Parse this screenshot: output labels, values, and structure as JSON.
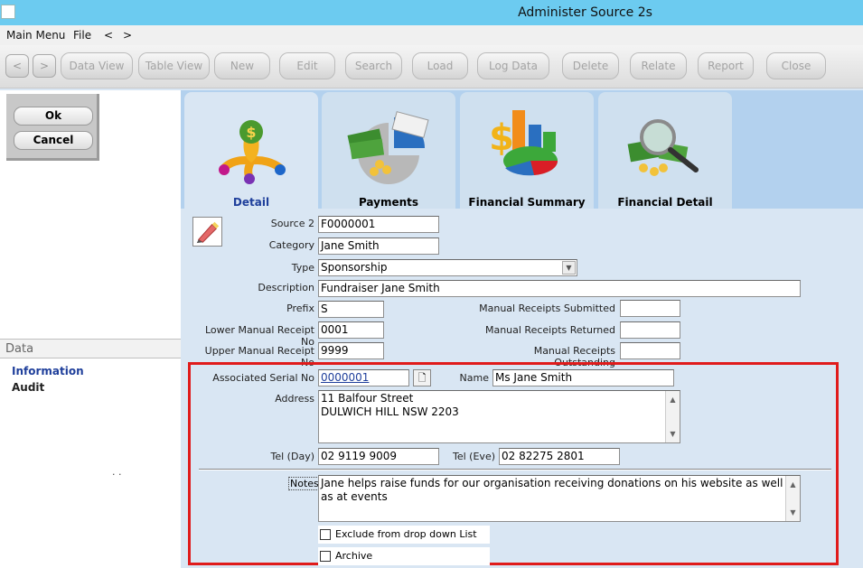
{
  "window": {
    "title": "Administer Source 2s"
  },
  "menu": {
    "items": [
      "Main Menu",
      "File",
      "<",
      ">"
    ]
  },
  "toolbar": {
    "nav_prev": "<",
    "nav_next": ">",
    "buttons": [
      "Data View",
      "Table View",
      "New",
      "Edit",
      "Search",
      "Load",
      "Log Data",
      "Delete",
      "Relate",
      "Report",
      "Close"
    ]
  },
  "dialog": {
    "ok": "Ok",
    "cancel": "Cancel"
  },
  "left": {
    "data_header": "Data",
    "links": [
      "Information",
      "Audit"
    ],
    "dots": ". ."
  },
  "tabs": [
    "Detail",
    "Payments",
    "Financial Summary",
    "Financial Detail"
  ],
  "form": {
    "source2": {
      "label": "Source 2",
      "value": "F0000001"
    },
    "category": {
      "label": "Category",
      "value": "Jane Smith"
    },
    "type": {
      "label": "Type",
      "value": "Sponsorship"
    },
    "description": {
      "label": "Description",
      "value": "Fundraiser Jane Smith"
    },
    "prefix": {
      "label": "Prefix",
      "value": "S"
    },
    "lower_receipt": {
      "label": "Lower Manual Receipt No",
      "value": "0001"
    },
    "upper_receipt": {
      "label": "Upper Manual Receipt No",
      "value": "9999"
    },
    "receipts_submitted": {
      "label": "Manual Receipts Submitted",
      "value": ""
    },
    "receipts_returned": {
      "label": "Manual Receipts Returned",
      "value": ""
    },
    "receipts_outstanding": {
      "label": "Manual Receipts Outstanding",
      "value": ""
    },
    "serial": {
      "label": "Associated Serial No",
      "value": "0000001"
    },
    "name": {
      "label": "Name",
      "value": "Ms Jane Smith"
    },
    "address": {
      "label": "Address",
      "line1": "11 Balfour Street",
      "line2": "DULWICH HILL NSW 2203"
    },
    "tel_day": {
      "label": "Tel (Day)",
      "value": "02 9119 9009"
    },
    "tel_eve": {
      "label": "Tel (Eve)",
      "value": "02 82275 2801"
    },
    "notes": {
      "label": "Notes",
      "value": "Jane helps raise funds for our organisation receiving donations on his website as well as at events"
    },
    "exclude_dropdown": {
      "label": "Exclude from drop down List",
      "checked": false
    },
    "archive": {
      "label": "Archive",
      "checked": false
    }
  },
  "colors": {
    "highlight_border": "#e01b1b",
    "tab_bar": "#b3d1ee",
    "form_bg": "#d9e6f3",
    "link": "#1f3f9b"
  }
}
